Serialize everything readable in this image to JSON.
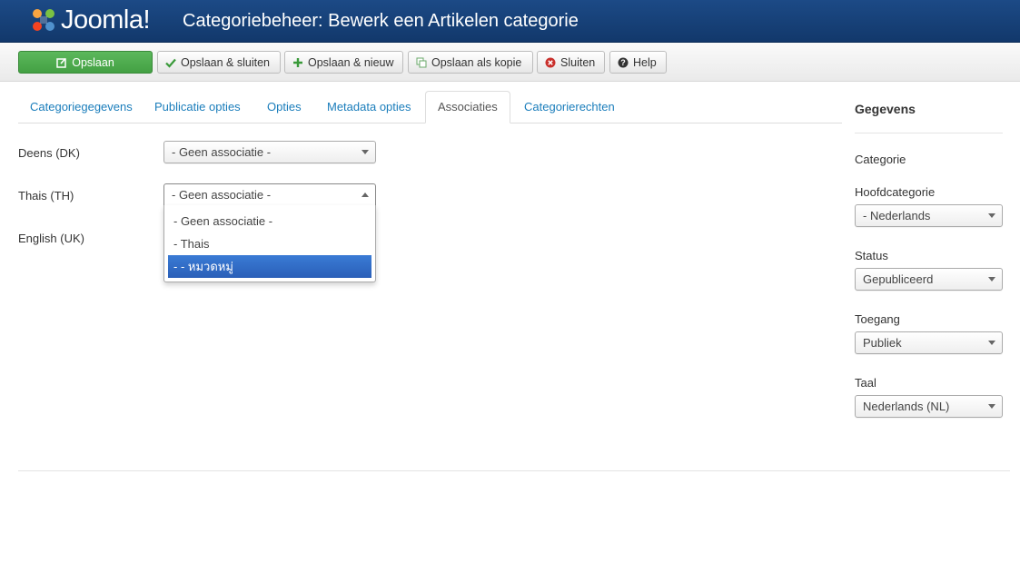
{
  "header": {
    "logo_text": "Joomla!",
    "title": "Categoriebeheer: Bewerk een Artikelen categorie"
  },
  "toolbar": {
    "save": "Opslaan",
    "save_close": "Opslaan & sluiten",
    "save_new": "Opslaan & nieuw",
    "save_copy": "Opslaan als kopie",
    "close": "Sluiten",
    "help": "Help"
  },
  "tabs": [
    "Categoriegegevens",
    "Publicatie opties",
    "Opties",
    "Metadata opties",
    "Associaties",
    "Categorierechten"
  ],
  "associations": {
    "rows": [
      {
        "label": "Deens (DK)",
        "value": "- Geen associatie -"
      },
      {
        "label": "Thais (TH)",
        "value": "- Geen associatie -"
      },
      {
        "label": "English (UK)",
        "value": ""
      }
    ],
    "open_dropdown_options": [
      "- Geen associatie -",
      "- Thais",
      "- - หมวดหมู่"
    ]
  },
  "sidebar": {
    "title": "Gegevens",
    "category_label": "Categorie",
    "parent_label": "Hoofdcategorie",
    "parent_value": "- Nederlands",
    "status_label": "Status",
    "status_value": "Gepubliceerd",
    "access_label": "Toegang",
    "access_value": "Publiek",
    "language_label": "Taal",
    "language_value": "Nederlands (NL)"
  },
  "colors": {
    "header_bg": "#1c4a86",
    "save_green": "#4cae4c",
    "link_blue": "#1a7dbb",
    "selection_blue": "#2f6ac7"
  }
}
